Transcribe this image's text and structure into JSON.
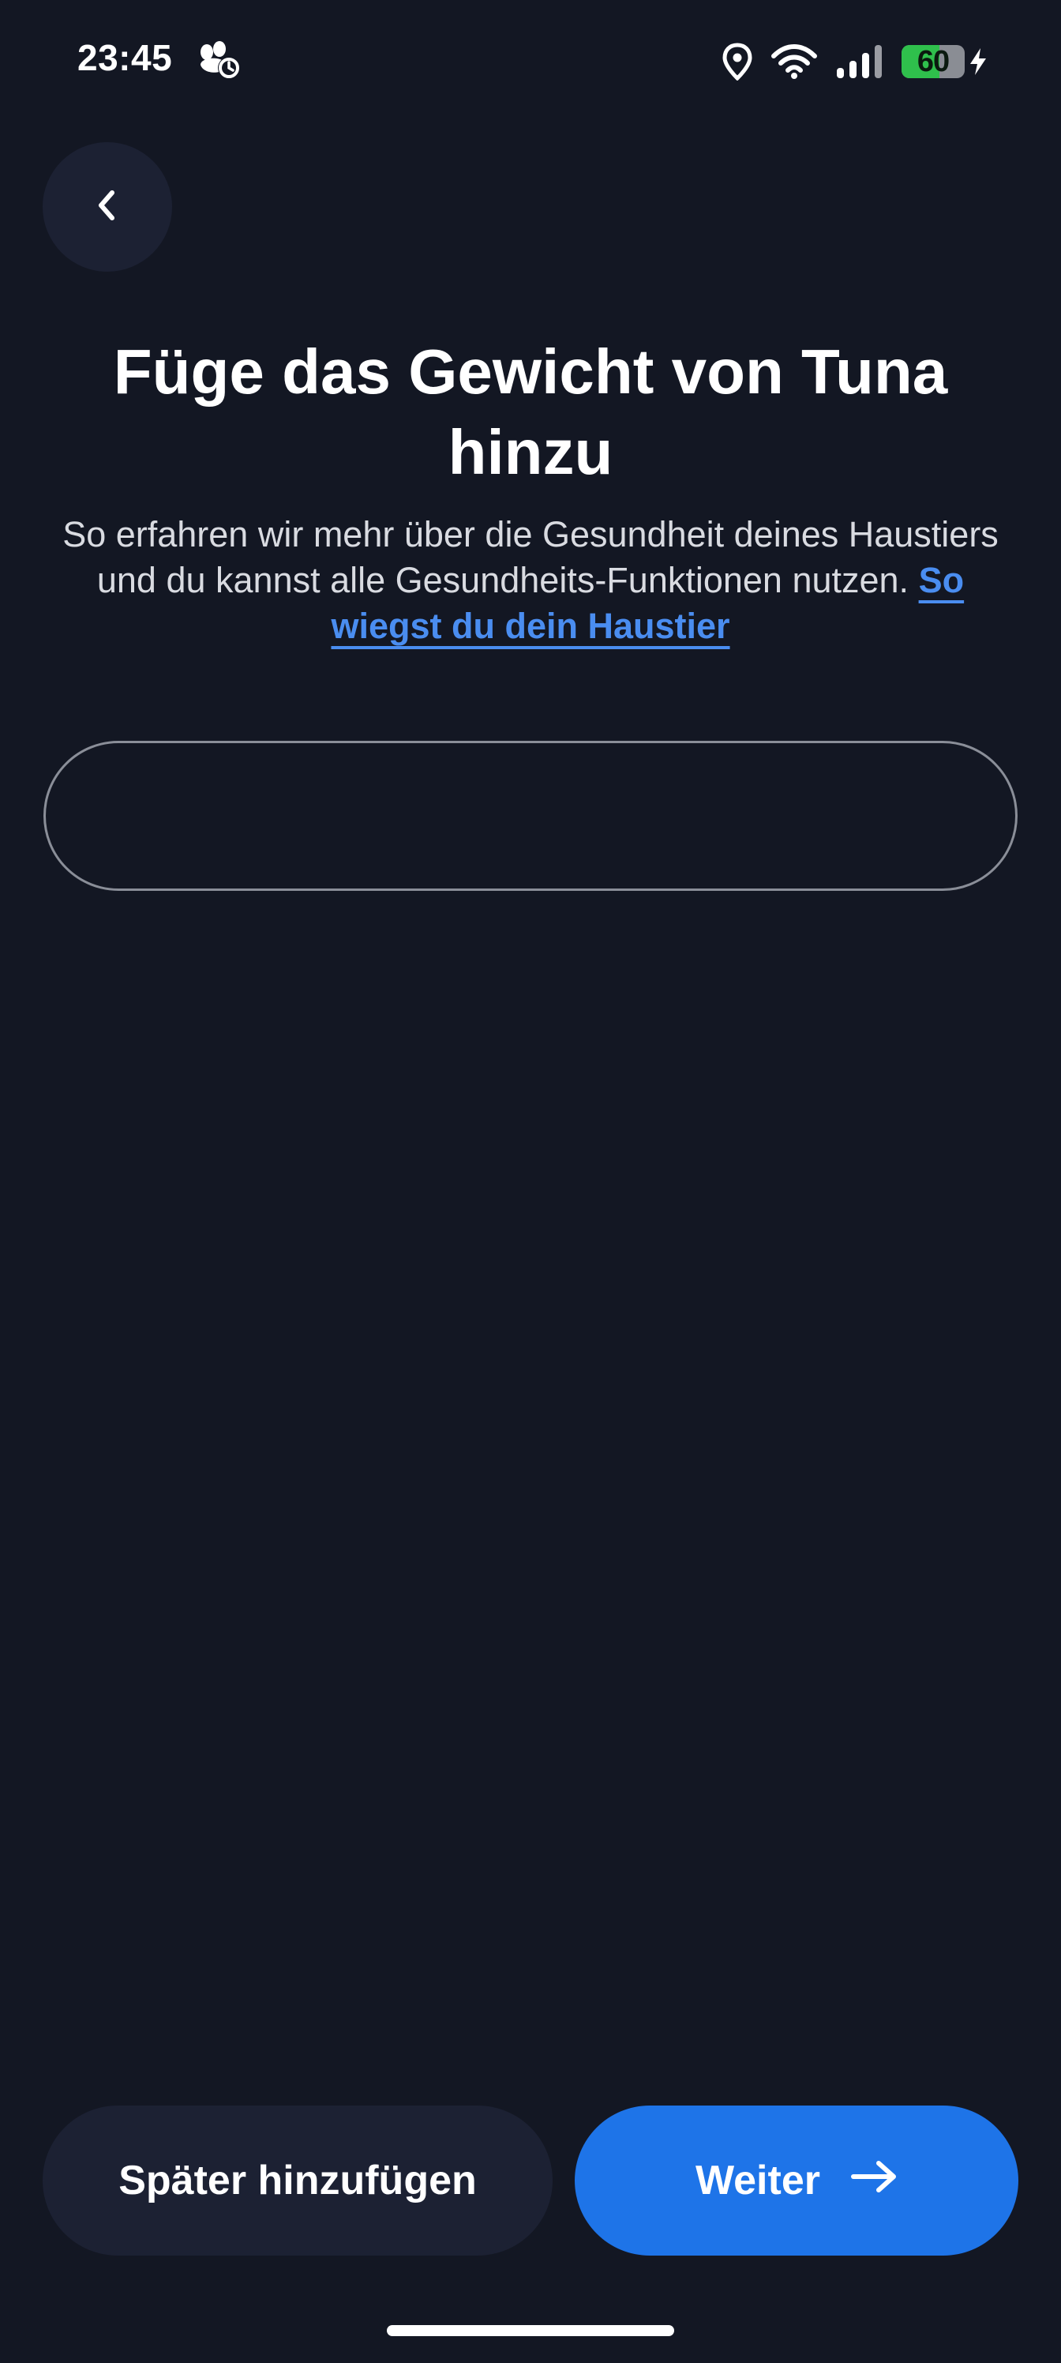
{
  "status_bar": {
    "time": "23:45",
    "app_icon": "paw-clock-icon",
    "icons": [
      "location-icon",
      "wifi-icon",
      "signal-icon",
      "battery-icon",
      "charging-icon"
    ],
    "battery_percent": "60",
    "battery_level": 0.6,
    "battery_color": "#2fc04c"
  },
  "header": {
    "back_icon": "chevron-left-icon"
  },
  "main": {
    "title": "Füge das Gewicht von Tuna hinzu",
    "subtitle": "So erfahren wir mehr über die Gesundheit deines Haustiers und du kannst alle Gesundheits-Funktionen nutzen.",
    "subtitle_link": "So wiegst du dein Haustier",
    "weight_input": {
      "value": "",
      "placeholder": ""
    }
  },
  "footer": {
    "later_label": "Später hinzufügen",
    "next_label": "Weiter",
    "next_icon": "arrow-right-icon"
  },
  "colors": {
    "background": "#131723",
    "surface": "#1c2133",
    "accent": "#1e74e8",
    "link": "#4a8df0"
  }
}
